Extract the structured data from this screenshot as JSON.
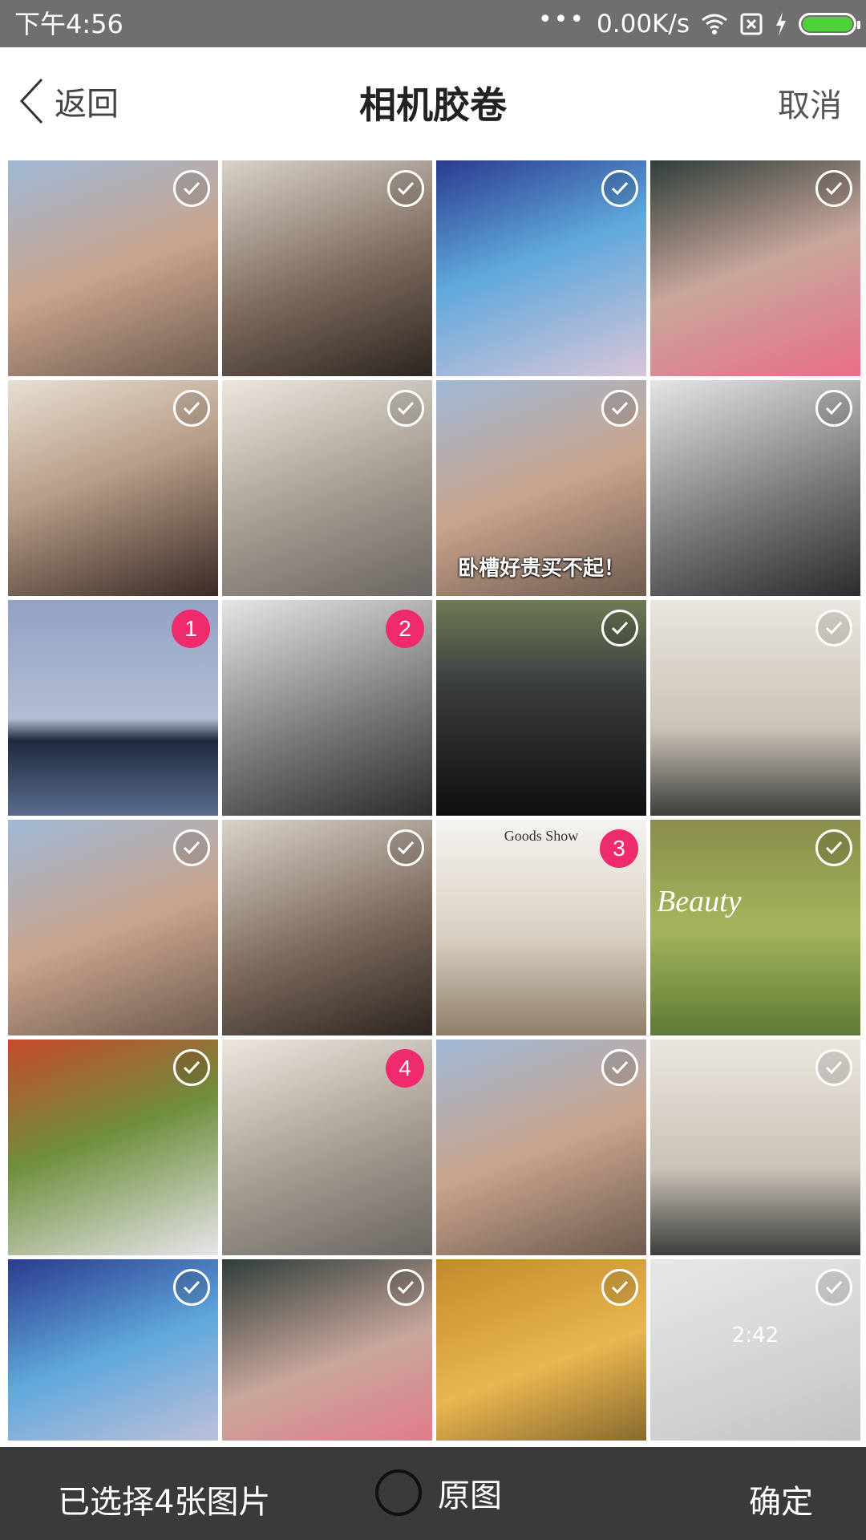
{
  "status_bar": {
    "time": "下午4:56",
    "dots": "•••",
    "speed": "0.00K/s",
    "icons": [
      "wifi-icon",
      "sim-off-icon",
      "charging-icon",
      "battery-icon"
    ],
    "battery_color": "#4cd137"
  },
  "header": {
    "back_label": "返回",
    "title": "相机胶卷",
    "cancel_label": "取消"
  },
  "grid": {
    "photos": [
      {
        "kind": "girl-beach",
        "state": "unchecked"
      },
      {
        "kind": "girl-dark-hair",
        "state": "unchecked"
      },
      {
        "kind": "girl-flower-hat",
        "state": "unchecked"
      },
      {
        "kind": "girl-pink-skirt",
        "state": "unchecked"
      },
      {
        "kind": "girl-smiling",
        "state": "unchecked"
      },
      {
        "kind": "girl-mirror",
        "state": "unchecked"
      },
      {
        "kind": "meme-face",
        "state": "unchecked",
        "caption": "卧槽好贵买不起！"
      },
      {
        "kind": "two-women-bw",
        "state": "unchecked"
      },
      {
        "kind": "winter-landscape",
        "state": "selected",
        "order": "1"
      },
      {
        "kind": "child-bw",
        "state": "selected",
        "order": "2"
      },
      {
        "kind": "sports-car",
        "state": "unchecked"
      },
      {
        "kind": "living-room",
        "state": "unchecked"
      },
      {
        "kind": "girl-cafe",
        "state": "unchecked"
      },
      {
        "kind": "woman-black-dress",
        "state": "unchecked"
      },
      {
        "kind": "bedroom",
        "state": "selected",
        "order": "3",
        "overlay": "Goods Show"
      },
      {
        "kind": "woman-coat-field",
        "state": "unchecked",
        "overlay": "Beauty"
      },
      {
        "kind": "flower-sculpture",
        "state": "unchecked"
      },
      {
        "kind": "girl-braids",
        "state": "selected",
        "order": "4"
      },
      {
        "kind": "woman-bridal",
        "state": "unchecked"
      },
      {
        "kind": "bedroom-gray",
        "state": "unchecked"
      },
      {
        "kind": "angel-statue",
        "state": "unchecked"
      },
      {
        "kind": "table-decor",
        "state": "unchecked"
      },
      {
        "kind": "child-leaves",
        "state": "unchecked"
      },
      {
        "kind": "phone-screen",
        "state": "unchecked",
        "overlay": "2:42"
      }
    ]
  },
  "bottom_bar": {
    "selected_text": "已选择4张图片",
    "original_label": "原图",
    "original_checked": false,
    "confirm_label": "确定"
  },
  "colors": {
    "status_bar_bg": "#6f6f6f",
    "bottom_bar_bg": "#3a3a3a",
    "selection_badge": "#ef2a6d"
  }
}
